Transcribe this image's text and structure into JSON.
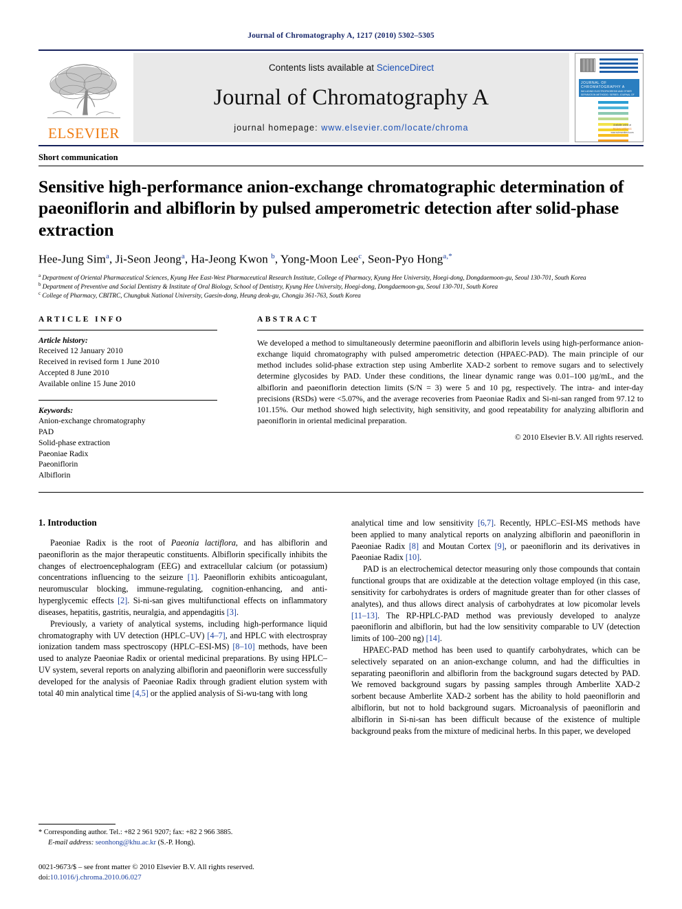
{
  "running_head": "Journal of Chromatography A, 1217 (2010) 5302–5305",
  "masthead": {
    "contents_prefix": "Contents lists available at ",
    "sciencedirect": "ScienceDirect",
    "journal_title": "Journal of Chromatography A",
    "homepage_prefix": "journal homepage: ",
    "homepage_url": "www.elsevier.com/locate/chroma",
    "publisher": "ELSEVIER",
    "publisher_logo_icon": "elsevier-tree-icon",
    "cover": {
      "band_title": "JOURNAL OF CHROMATOGRAPHY A",
      "band_subtitle": "INCLUDING ELECTROPHORESIS AND OTHER SEPARATION METHODS / SERIES: JOURNAL OF CHROMATOGRAPHY AND BIOMEDICAL APPLICATIONS",
      "foot_top": "Available online at",
      "foot_brand": "ScienceDirect",
      "foot_url": "www.sciencedirect.com"
    }
  },
  "article": {
    "kind": "Short communication",
    "title": "Sensitive high-performance anion-exchange chromatographic determination of paeoniflorin and albiflorin by pulsed amperometric detection after solid-phase extraction",
    "authors_html": "Hee-Jung Sim<sup>a</sup>, Ji-Seon Jeong<sup>a</sup>, Ha-Jeong Kwon <sup>b</sup>, Yong-Moon Lee<sup>c</sup>, Seon-Pyo Hong<sup>a,*</sup>",
    "affiliations": [
      "Department of Oriental Pharmaceutical Sciences, Kyung Hee East-West Pharmaceutical Research Institute, College of Pharmacy, Kyung Hee University, Hoegi-dong, Dongdaemoon-gu, Seoul 130-701, South Korea",
      "Department of Preventive and Social Dentistry & Institute of Oral Biology, School of Dentistry, Kyung Hee University, Hoegi-dong, Dongdaemoon-gu, Seoul 130-701, South Korea",
      "College of Pharmacy, CBITRC, Chungbuk National University, Gaesin-dong, Heung deok-gu, Chongju 361-763, South Korea"
    ],
    "affiliation_markers": [
      "a",
      "b",
      "c"
    ]
  },
  "article_info": {
    "heading": "ARTICLE INFO",
    "history_label": "Article history:",
    "history": [
      "Received 12 January 2010",
      "Received in revised form 1 June 2010",
      "Accepted 8 June 2010",
      "Available online 15 June 2010"
    ],
    "keywords_label": "Keywords:",
    "keywords": [
      "Anion-exchange chromatography",
      "PAD",
      "Solid-phase extraction",
      "Paeoniae Radix",
      "Paeoniflorin",
      "Albiflorin"
    ]
  },
  "abstract": {
    "heading": "ABSTRACT",
    "text": "We developed a method to simultaneously determine paeoniflorin and albiflorin levels using high-performance anion-exchange liquid chromatography with pulsed amperometric detection (HPAEC-PAD). The main principle of our method includes solid-phase extraction step using Amberlite XAD-2 sorbent to remove sugars and to selectively determine glycosides by PAD. Under these conditions, the linear dynamic range was 0.01–100 µg/mL, and the albiflorin and paeoniflorin detection limits (S/N = 3) were 5 and 10 pg, respectively. The intra- and inter-day precisions (RSDs) were <5.07%, and the average recoveries from Paeoniae Radix and Si-ni-san ranged from 97.12 to 101.15%. Our method showed high selectivity, high sensitivity, and good repeatability for analyzing albiflorin and paeoniflorin in oriental medicinal preparation.",
    "copyright": "© 2010 Elsevier B.V. All rights reserved."
  },
  "body": {
    "section_number_title": "1. Introduction",
    "left_paragraphs": [
      "Paeoniae Radix is the root of <i>Paeonia lactiflora</i>, and has albiflorin and paeoniflorin as the major therapeutic constituents. Albiflorin specifically inhibits the changes of electroencephalogram (EEG) and extracellular calcium (or potassium) concentrations influencing to the seizure <span class=\"ref\">[1]</span>. Paeoniflorin exhibits anticoagulant, neuromuscular blocking, immune-regulating, cognition-enhancing, and anti-hyperglycemic effects <span class=\"ref\">[2]</span>. Si-ni-san gives multifunctional effects on inflammatory diseases, hepatitis, gastritis, neuralgia, and appendagitis <span class=\"ref\">[3]</span>.",
      "Previously, a variety of analytical systems, including high-performance liquid chromatography with UV detection (HPLC–UV) <span class=\"ref\">[4–7]</span>, and HPLC with electrospray ionization tandem mass spectroscopy (HPLC–ESI-MS) <span class=\"ref\">[8–10]</span> methods, have been used to analyze Paeoniae Radix or oriental medicinal preparations. By using HPLC–UV system, several reports on analyzing albiflorin and paeoniflorin were successfully developed for the analysis of Paeoniae Radix through gradient elution system with total 40 min analytical time <span class=\"ref\">[4,5]</span> or the applied analysis of Si-wu-tang with long"
    ],
    "right_paragraphs": [
      "analytical time and low sensitivity <span class=\"ref\">[6,7]</span>. Recently, HPLC–ESI-MS methods have been applied to many analytical reports on analyzing albiflorin and paeoniflorin in Paeoniae Radix <span class=\"ref\">[8]</span> and Moutan Cortex <span class=\"ref\">[9]</span>, or paeoniflorin and its derivatives in Paeoniae Radix <span class=\"ref\">[10]</span>.",
      "PAD is an electrochemical detector measuring only those compounds that contain functional groups that are oxidizable at the detection voltage employed (in this case, sensitivity for carbohydrates is orders of magnitude greater than for other classes of analytes), and thus allows direct analysis of carbohydrates at low picomolar levels <span class=\"ref\">[11–13]</span>. The RP-HPLC-PAD method was previously developed to analyze paeoniflorin and albiflorin, but had the low sensitivity comparable to UV (detection limits of 100–200 ng) <span class=\"ref\">[14]</span>.",
      "HPAEC-PAD method has been used to quantify carbohydrates, which can be selectively separated on an anion-exchange column, and had the difficulties in separating paeoniflorin and albiflorin from the background sugars detected by PAD. We removed background sugars by passing samples through Amberlite XAD-2 sorbent because Amberlite XAD-2 sorbent has the ability to hold paeoniflorin and albiflorin, but not to hold background sugars. Microanalysis of paeoniflorin and albiflorin in Si-ni-san has been difficult because of the existence of multiple background peaks from the mixture of medicinal herbs. In this paper, we developed"
    ]
  },
  "footnotes": {
    "corresponding": "* Corresponding author. Tel.: +82 2 961 9207; fax: +82 2 966 3885.",
    "email_label": "E-mail address:",
    "email": "seonhong@khu.ac.kr",
    "email_suffix": "(S.-P. Hong).",
    "issn_line": "0021-9673/$ – see front matter © 2010 Elsevier B.V. All rights reserved.",
    "doi_label": "doi:",
    "doi": "10.1016/j.chroma.2010.06.027"
  },
  "colors": {
    "link": "#1a3f9e",
    "rule": "#14205a",
    "elsevier_orange": "#ef7b10",
    "cover_blue": "#2a7ec0"
  }
}
